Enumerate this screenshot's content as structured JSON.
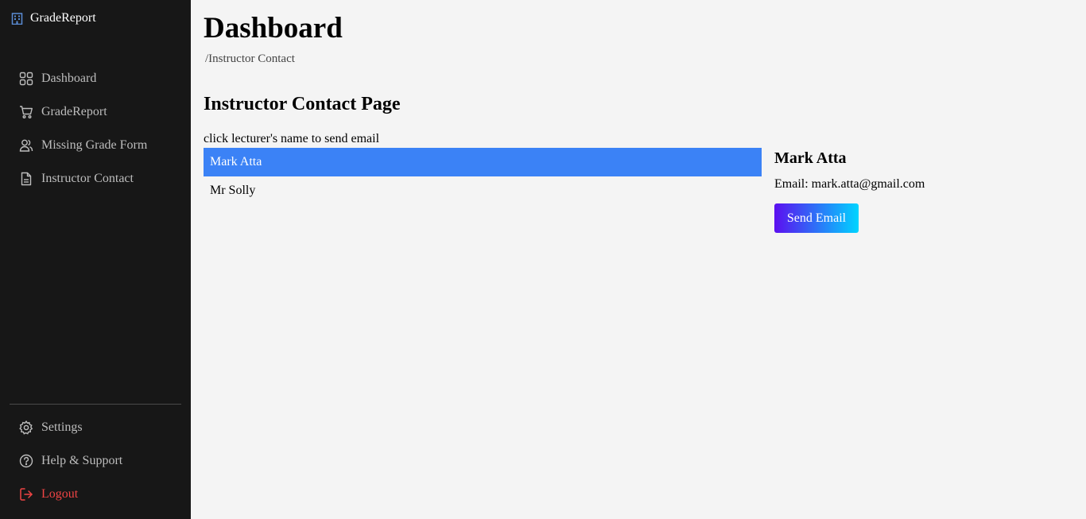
{
  "brand": {
    "title": "GradeReport",
    "icon": "building-icon",
    "icon_color": "#5b8dd6"
  },
  "sidebar": {
    "items": [
      {
        "label": "Dashboard",
        "icon": "grid-icon"
      },
      {
        "label": "GradeReport",
        "icon": "cart-icon"
      },
      {
        "label": "Missing Grade Form",
        "icon": "users-icon"
      },
      {
        "label": "Instructor Contact",
        "icon": "document-icon"
      }
    ],
    "bottom": [
      {
        "label": "Settings",
        "icon": "gear-icon"
      },
      {
        "label": "Help & Support",
        "icon": "help-icon"
      },
      {
        "label": "Logout",
        "icon": "logout-icon",
        "color": "#ef4444"
      }
    ]
  },
  "header": {
    "title": "Dashboard",
    "breadcrumb": "/Instructor Contact"
  },
  "main": {
    "section_title": "Instructor Contact Page",
    "hint": "click lecturer's name to send email",
    "lecturers": [
      {
        "name": "Mark Atta",
        "selected": true
      },
      {
        "name": "Mr Solly",
        "selected": false
      }
    ],
    "selected_color": "#3b82f6",
    "detail": {
      "name": "Mark Atta",
      "email_label": "Email:",
      "email": "mark.atta@gmail.com",
      "button_label": "Send Email"
    }
  }
}
